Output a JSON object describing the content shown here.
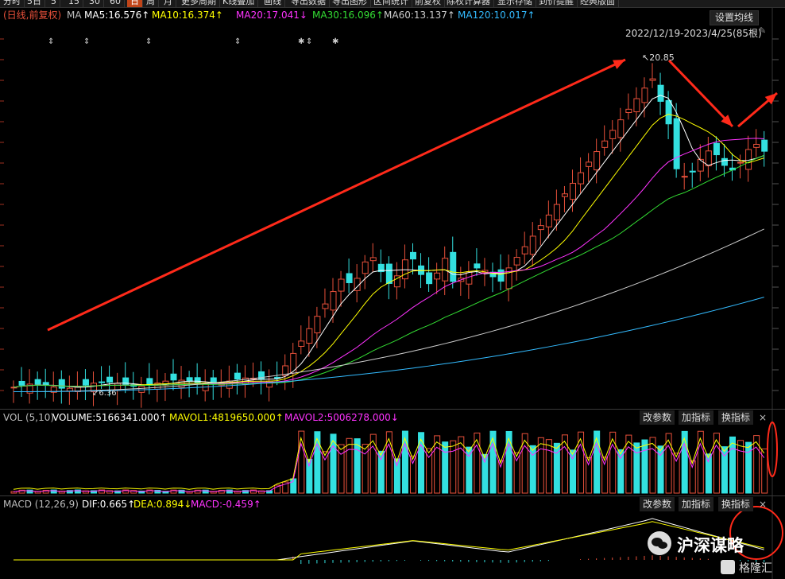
{
  "toolbar": {
    "tabs": [
      "分时",
      "5日",
      "5",
      "15",
      "30",
      "60",
      "日",
      "周",
      "月",
      "更多周期",
      "K线叠加",
      "画线",
      "导出数据",
      "导出图形",
      "区间统计",
      "前复权",
      "除权计算器",
      "显示存储",
      "到价提醒",
      "经典版面"
    ],
    "active": "日"
  },
  "main": {
    "label": "(日线,前复权)",
    "ma_prefix": "MA",
    "ma": [
      {
        "text": "MA5:16.576↑",
        "color": "#ffffff"
      },
      {
        "text": "MA10:16.374↑",
        "color": "#ffff00"
      },
      {
        "text": "MA20:17.041↓",
        "color": "#ff33ff"
      },
      {
        "text": "MA30:16.096↑",
        "color": "#33dd33"
      },
      {
        "text": "MA60:13.137↑",
        "color": "#cccccc"
      },
      {
        "text": "MA120:10.017↑",
        "color": "#33bbff"
      }
    ],
    "settings_button": "设置均线",
    "date_range": "2022/12/19-2023/4/25(85根)",
    "high_label": "20.85",
    "low_label": "6.36"
  },
  "volume": {
    "label": "VOL (5,10)",
    "volume": "VOLUME:5166341.000↑",
    "mavol1": "MAVOL1:4819650.000↑",
    "mavol2": "MAVOL2:5006278.000↓",
    "buttons": [
      "改参数",
      "加指标",
      "换指标"
    ],
    "close": "×"
  },
  "macd": {
    "label": "MACD (12,26,9)",
    "dif": "DIF:0.665↑",
    "dea": "DEA:0.894↓",
    "macd": "MACD:-0.459↑",
    "buttons": [
      "改参数",
      "加指标",
      "换指标"
    ],
    "close": "×"
  },
  "watermark": {
    "brand": "沪深谋略",
    "site": "格隆汇"
  },
  "colors": {
    "up": "#e8503a",
    "down": "#33e0e0",
    "ma5": "#ffffff",
    "ma10": "#ffff00",
    "ma20": "#ff33ff",
    "ma30": "#33dd33",
    "ma60": "#cccccc",
    "ma120": "#33bbff",
    "annotation": "#ff2a1a"
  }
}
